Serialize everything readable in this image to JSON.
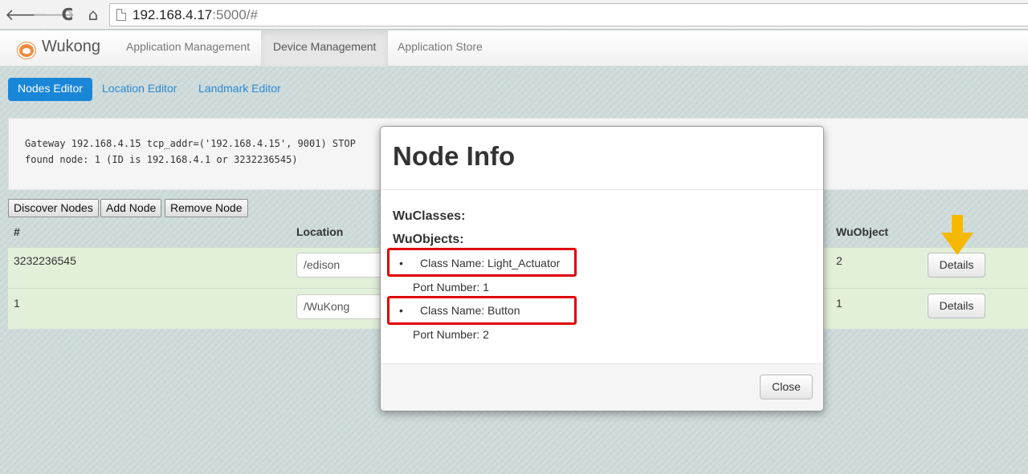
{
  "browser": {
    "url_host": "192.168.4.17",
    "url_rest": ":5000/#",
    "back_glyph": "🡐",
    "forward_glyph": "🡒",
    "reload_glyph": "C",
    "home_glyph": "⌂"
  },
  "navbar": {
    "brand": "Wukong",
    "items": [
      "Application Management",
      "Device Management",
      "Application Store"
    ],
    "active": "Device Management"
  },
  "subtabs": [
    "Nodes Editor",
    "Location Editor",
    "Landmark Editor"
  ],
  "log": [
    "Gateway 192.168.4.15 tcp_addr=('192.168.4.15', 9001) STOP",
    "found node: 1 (ID is 192.168.4.1 or 3232236545)"
  ],
  "toolbar": {
    "discover_label": "Discover Nodes",
    "add_label": "Add Node",
    "remove_label": "Remove Node"
  },
  "table": {
    "headers": [
      "#",
      "Location",
      "WuObject"
    ],
    "rows": [
      {
        "id": "3232236545",
        "location": "/edison",
        "wuobject": "2",
        "action": "Details"
      },
      {
        "id": "1",
        "location": "/WuKong",
        "wuobject": "1",
        "action": "Details"
      }
    ]
  },
  "modal": {
    "title": "Node Info",
    "wuclasses_label": "WuClasses:",
    "wuobjects_label": "WuObjects:",
    "bullet": "•",
    "objects": [
      {
        "class_name": "Class Name: Light_Actuator",
        "port": "Port Number: 1"
      },
      {
        "class_name": "Class Name: Button",
        "port": "Port Number: 2"
      }
    ],
    "close_label": "Close"
  },
  "colors": {
    "accent": "#1a86d8",
    "row_bg": "#e2f0d9",
    "highlight": "#e00000",
    "arrow": "#f5b800"
  }
}
